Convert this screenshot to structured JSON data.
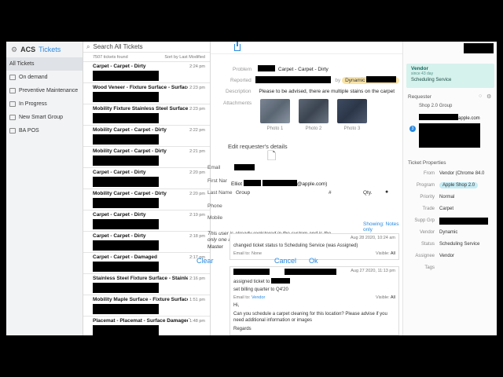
{
  "brand": {
    "acs": "ACS",
    "tickets": "Tickets"
  },
  "sidebar": {
    "items": [
      {
        "label": "All Tickets"
      },
      {
        "label": "On demand"
      },
      {
        "label": "Preventive Maintenance"
      },
      {
        "label": "In Progress"
      },
      {
        "label": "New Smart Group"
      },
      {
        "label": "BA POS"
      }
    ]
  },
  "list": {
    "search_placeholder": "Search All Tickets",
    "count": "7507 tickets found",
    "sort": "Sort by Last Modified",
    "tickets": [
      {
        "title": "Carpet - Carpet - Dirty",
        "time": "2:24 pm"
      },
      {
        "title": "Wood Veneer - Fixture Surface - Surface",
        "time": "2:23 pm"
      },
      {
        "title": "Mobility Fixture Stainless Steel Surface",
        "time": "2:23 pm"
      },
      {
        "title": "Mobility Carpet - Carpet - Dirty",
        "time": "2:22 pm"
      },
      {
        "title": "Mobility Carpet - Carpet - Dirty",
        "time": "2:21 pm"
      },
      {
        "title": "Carpet - Carpet - Dirty",
        "time": "2:20 pm"
      },
      {
        "title": "Mobility Carpet - Carpet - Dirty",
        "time": "2:20 pm"
      },
      {
        "title": "Carpet - Carpet - Dirty",
        "time": "2:19 pm"
      },
      {
        "title": "Carpet - Carpet - Dirty",
        "time": "2:18 pm"
      },
      {
        "title": "Carpet - Carpet - Damaged",
        "time": "2:17 pm"
      },
      {
        "title": "Stainless Steel Fixture Surface - Stainless",
        "time": "2:16 pm"
      },
      {
        "title": "Mobility Maple Surface - Fixture Surface",
        "time": "1:51 pm"
      },
      {
        "title": "Placemat - Placemat - Surface Damaged",
        "time": "1:48 pm"
      }
    ]
  },
  "detail": {
    "problem_label": "Problem",
    "problem_value": "Carpet - Carpet - Dirty",
    "reported_label": "Reported",
    "reported_by": "by",
    "reported_badge": "Dynamic",
    "description_label": "Description",
    "description_value": "Please to be advised, there are multiple stains on the carpet",
    "attachments_label": "Attachments",
    "photos": [
      "Photo 1",
      "Photo 2",
      "Photo 3"
    ],
    "edit_requester": "Edit requester's details",
    "email_label": "Email",
    "first_name_label": "First Nar",
    "first_name_value": "Elliot",
    "email_value_suffix": "@apple.com)",
    "last_name_label": "Last Name",
    "group_col": "Group",
    "hash_col": "#",
    "qty_col": "Qty.",
    "phone_label": "Phone",
    "mobile_label": "Mobile",
    "showing_notes": "Showing: Notes only",
    "registered_msg": "This user is already registered in the system and is the only one allowed",
    "master_label": "Master",
    "clear_btn": "Clear",
    "cancel_btn": "Cancel",
    "ok_btn": "Ok",
    "note1": {
      "date": "Aug 28 2020, 10:24 am",
      "text": "changed ticket status to Scheduling Service (was Assigned)",
      "email_to": "Email to:",
      "email_val": "None",
      "visible": "Visible:",
      "visible_val": "All"
    },
    "note2": {
      "date": "Aug 27 2020, 11:13 pm",
      "line1": "assigned ticket to",
      "line2": "set billing quarter to Q4'20",
      "email_to": "Email to:",
      "email_val": "Vendor",
      "visible": "Visible:",
      "visible_val": "All",
      "body1": "Hi,",
      "body2": "Can you schedule a carpet cleaning for this location? Please advise if you need additional information or images",
      "body3": "Regards"
    }
  },
  "right": {
    "vendor_title": "Vendor",
    "vendor_sub": "since 43 day",
    "vendor_value": "Scheduling Service",
    "requester_title": "Requester",
    "requester_group": "Shop 2.0 Group",
    "requester_email_suffix": "apple.com",
    "props_title": "Ticket Properties",
    "props": [
      {
        "label": "From",
        "value": "Vendor (Chrome 84.0"
      },
      {
        "label": "Program",
        "value": "Apple Shop 2.0"
      },
      {
        "label": "Priority",
        "value": "Normal"
      },
      {
        "label": "Trade",
        "value": "Carpet"
      },
      {
        "label": "Supp Grp",
        "value": ""
      },
      {
        "label": "Vendor",
        "value": "Dynamic"
      },
      {
        "label": "Status",
        "value": "Scheduling Service"
      },
      {
        "label": "Assignee",
        "value": "Vendor"
      },
      {
        "label": "Tags",
        "value": ""
      }
    ]
  },
  "colors": {
    "accent": "#2a8ae0",
    "vendor_card": "#d6f2ec",
    "badge": "#f8e3a6"
  }
}
